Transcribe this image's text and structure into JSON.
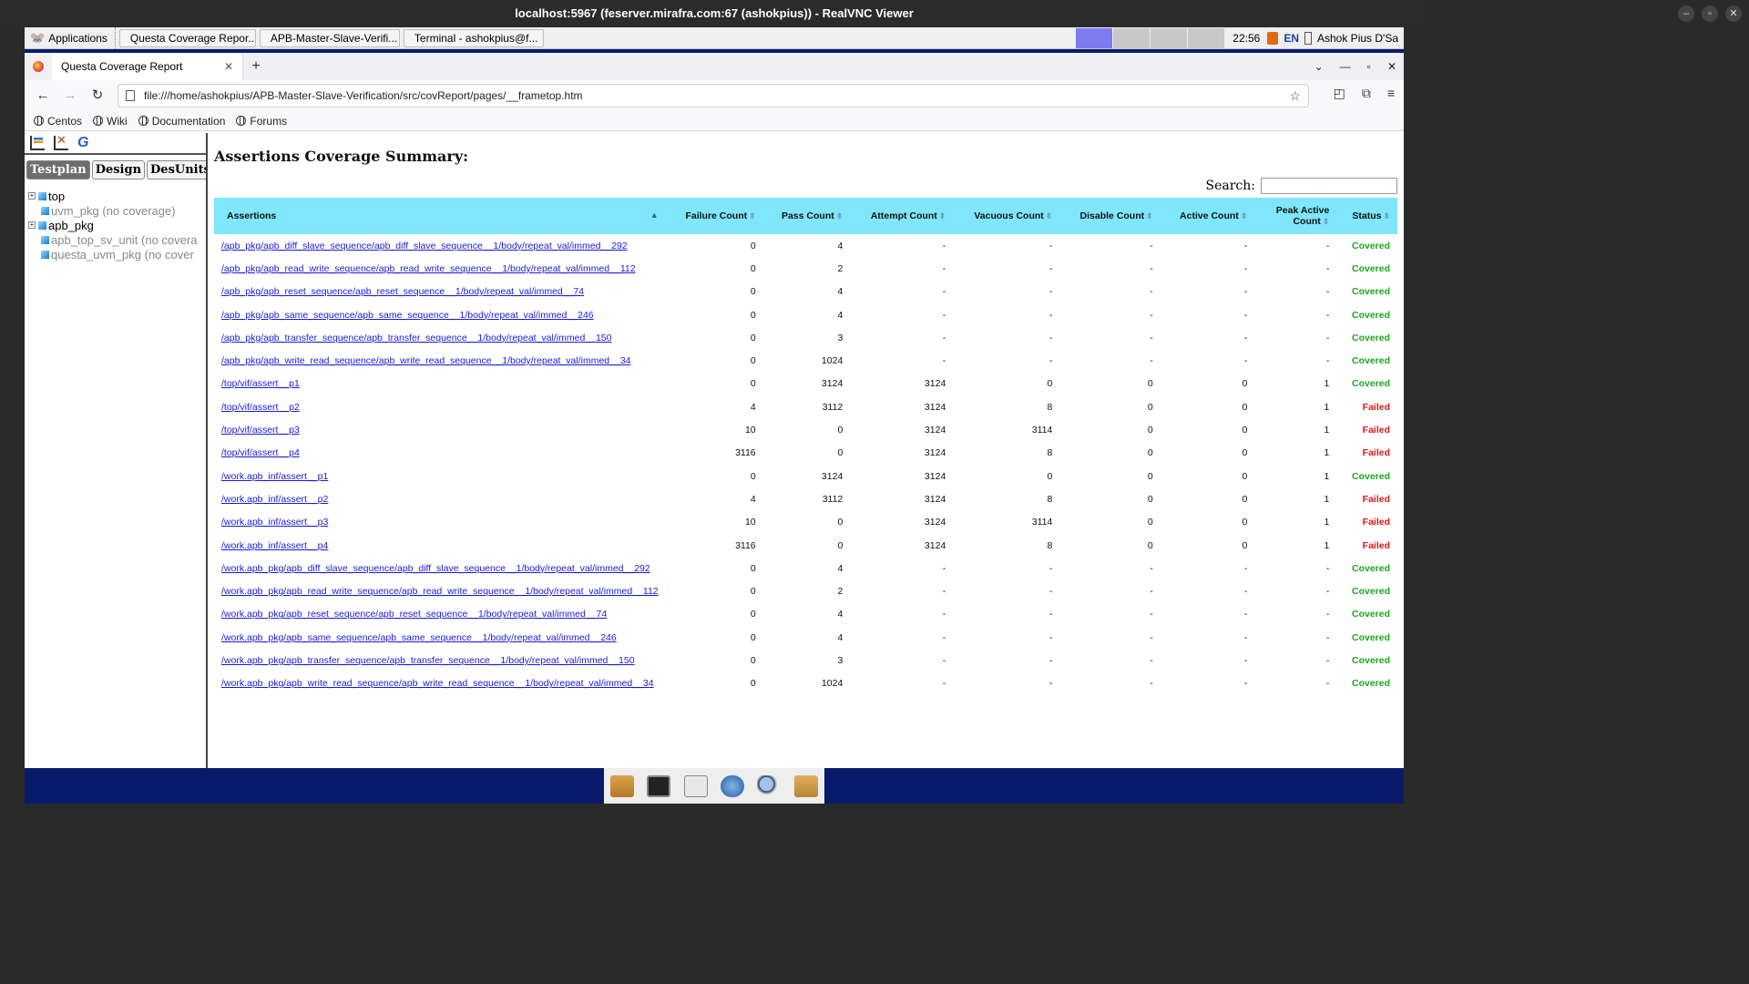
{
  "vnc": {
    "title": "localhost:5967 (feserver.mirafra.com:67 (ashokpius)) - RealVNC Viewer",
    "controls": [
      "–",
      "▫",
      "✕"
    ]
  },
  "taskbar": {
    "applications_label": "Applications",
    "tasks": [
      {
        "label": "Questa Coverage Repor...",
        "icon": "firefox-icon"
      },
      {
        "label": "APB-Master-Slave-Verifi...",
        "icon": "folder-icon"
      },
      {
        "label": "Terminal - ashokpius@f...",
        "icon": "terminal-icon"
      }
    ],
    "clock": "22:56",
    "lang": "EN",
    "user": "Ashok Pius D'Sa"
  },
  "browser": {
    "tab_title": "Questa Coverage Report",
    "new_tab": "+",
    "tab_close": "✕",
    "url": "file:///home/ashokpius/APB-Master-Slave-Verification/src/covReport/pages/__frametop.htm",
    "bookmarks": [
      "Centos",
      "Wiki",
      "Documentation",
      "Forums"
    ]
  },
  "left_panel": {
    "tabs": [
      "Testplan",
      "Design",
      "DesUnits"
    ],
    "active_tab": "Testplan",
    "tree": [
      {
        "label": "top",
        "expandable": true,
        "dim": false
      },
      {
        "label": "uvm_pkg (no coverage)",
        "expandable": false,
        "dim": true
      },
      {
        "label": "apb_pkg",
        "expandable": true,
        "dim": false
      },
      {
        "label": "apb_top_sv_unit (no covera",
        "expandable": false,
        "dim": true
      },
      {
        "label": "questa_uvm_pkg (no cover",
        "expandable": false,
        "dim": true
      }
    ]
  },
  "main": {
    "heading": "Assertions Coverage Summary:",
    "search_label": "Search:",
    "search_value": "",
    "columns": [
      "Assertions",
      "Failure Count",
      "Pass Count",
      "Attempt Count",
      "Vacuous Count",
      "Disable Count",
      "Active Count",
      "Peak Active Count",
      "Status"
    ],
    "rows": [
      [
        "/apb_pkg/apb_diff_slave_sequence/apb_diff_slave_sequence__1/body/repeat_val/immed__292",
        "0",
        "4",
        "-",
        "-",
        "-",
        "-",
        "-",
        "Covered"
      ],
      [
        "/apb_pkg/apb_read_write_sequence/apb_read_write_sequence__1/body/repeat_val/immed__112",
        "0",
        "2",
        "-",
        "-",
        "-",
        "-",
        "-",
        "Covered"
      ],
      [
        "/apb_pkg/apb_reset_sequence/apb_reset_sequence__1/body/repeat_val/immed__74",
        "0",
        "4",
        "-",
        "-",
        "-",
        "-",
        "-",
        "Covered"
      ],
      [
        "/apb_pkg/apb_same_sequence/apb_same_sequence__1/body/repeat_val/immed__246",
        "0",
        "4",
        "-",
        "-",
        "-",
        "-",
        "-",
        "Covered"
      ],
      [
        "/apb_pkg/apb_transfer_sequence/apb_transfer_sequence__1/body/repeat_val/immed__150",
        "0",
        "3",
        "-",
        "-",
        "-",
        "-",
        "-",
        "Covered"
      ],
      [
        "/apb_pkg/apb_write_read_sequence/apb_write_read_sequence__1/body/repeat_val/immed__34",
        "0",
        "1024",
        "-",
        "-",
        "-",
        "-",
        "-",
        "Covered"
      ],
      [
        "/top/vif/assert__p1",
        "0",
        "3124",
        "3124",
        "0",
        "0",
        "0",
        "1",
        "Covered"
      ],
      [
        "/top/vif/assert__p2",
        "4",
        "3112",
        "3124",
        "8",
        "0",
        "0",
        "1",
        "Failed"
      ],
      [
        "/top/vif/assert__p3",
        "10",
        "0",
        "3124",
        "3114",
        "0",
        "0",
        "1",
        "Failed"
      ],
      [
        "/top/vif/assert__p4",
        "3116",
        "0",
        "3124",
        "8",
        "0",
        "0",
        "1",
        "Failed"
      ],
      [
        "/work.apb_inf/assert__p1",
        "0",
        "3124",
        "3124",
        "0",
        "0",
        "0",
        "1",
        "Covered"
      ],
      [
        "/work.apb_inf/assert__p2",
        "4",
        "3112",
        "3124",
        "8",
        "0",
        "0",
        "1",
        "Failed"
      ],
      [
        "/work.apb_inf/assert__p3",
        "10",
        "0",
        "3124",
        "3114",
        "0",
        "0",
        "1",
        "Failed"
      ],
      [
        "/work.apb_inf/assert__p4",
        "3116",
        "0",
        "3124",
        "8",
        "0",
        "0",
        "1",
        "Failed"
      ],
      [
        "/work.apb_pkg/apb_diff_slave_sequence/apb_diff_slave_sequence__1/body/repeat_val/immed__292",
        "0",
        "4",
        "-",
        "-",
        "-",
        "-",
        "-",
        "Covered"
      ],
      [
        "/work.apb_pkg/apb_read_write_sequence/apb_read_write_sequence__1/body/repeat_val/immed__112",
        "0",
        "2",
        "-",
        "-",
        "-",
        "-",
        "-",
        "Covered"
      ],
      [
        "/work.apb_pkg/apb_reset_sequence/apb_reset_sequence__1/body/repeat_val/immed__74",
        "0",
        "4",
        "-",
        "-",
        "-",
        "-",
        "-",
        "Covered"
      ],
      [
        "/work.apb_pkg/apb_same_sequence/apb_same_sequence__1/body/repeat_val/immed__246",
        "0",
        "4",
        "-",
        "-",
        "-",
        "-",
        "-",
        "Covered"
      ],
      [
        "/work.apb_pkg/apb_transfer_sequence/apb_transfer_sequence__1/body/repeat_val/immed__150",
        "0",
        "3",
        "-",
        "-",
        "-",
        "-",
        "-",
        "Covered"
      ],
      [
        "/work.apb_pkg/apb_write_read_sequence/apb_write_read_sequence__1/body/repeat_val/immed__34",
        "0",
        "1024",
        "-",
        "-",
        "-",
        "-",
        "-",
        "Covered"
      ]
    ]
  },
  "colors": {
    "header_bg": "#7fe6fb",
    "covered": "#1fa51f",
    "failed": "#e01818",
    "link": "#1a1ad8",
    "desktop": "#0a1a6b"
  },
  "dock": [
    "file-manager-icon",
    "terminal-icon",
    "notes-icon",
    "web-browser-icon",
    "search-icon",
    "folder-icon"
  ]
}
